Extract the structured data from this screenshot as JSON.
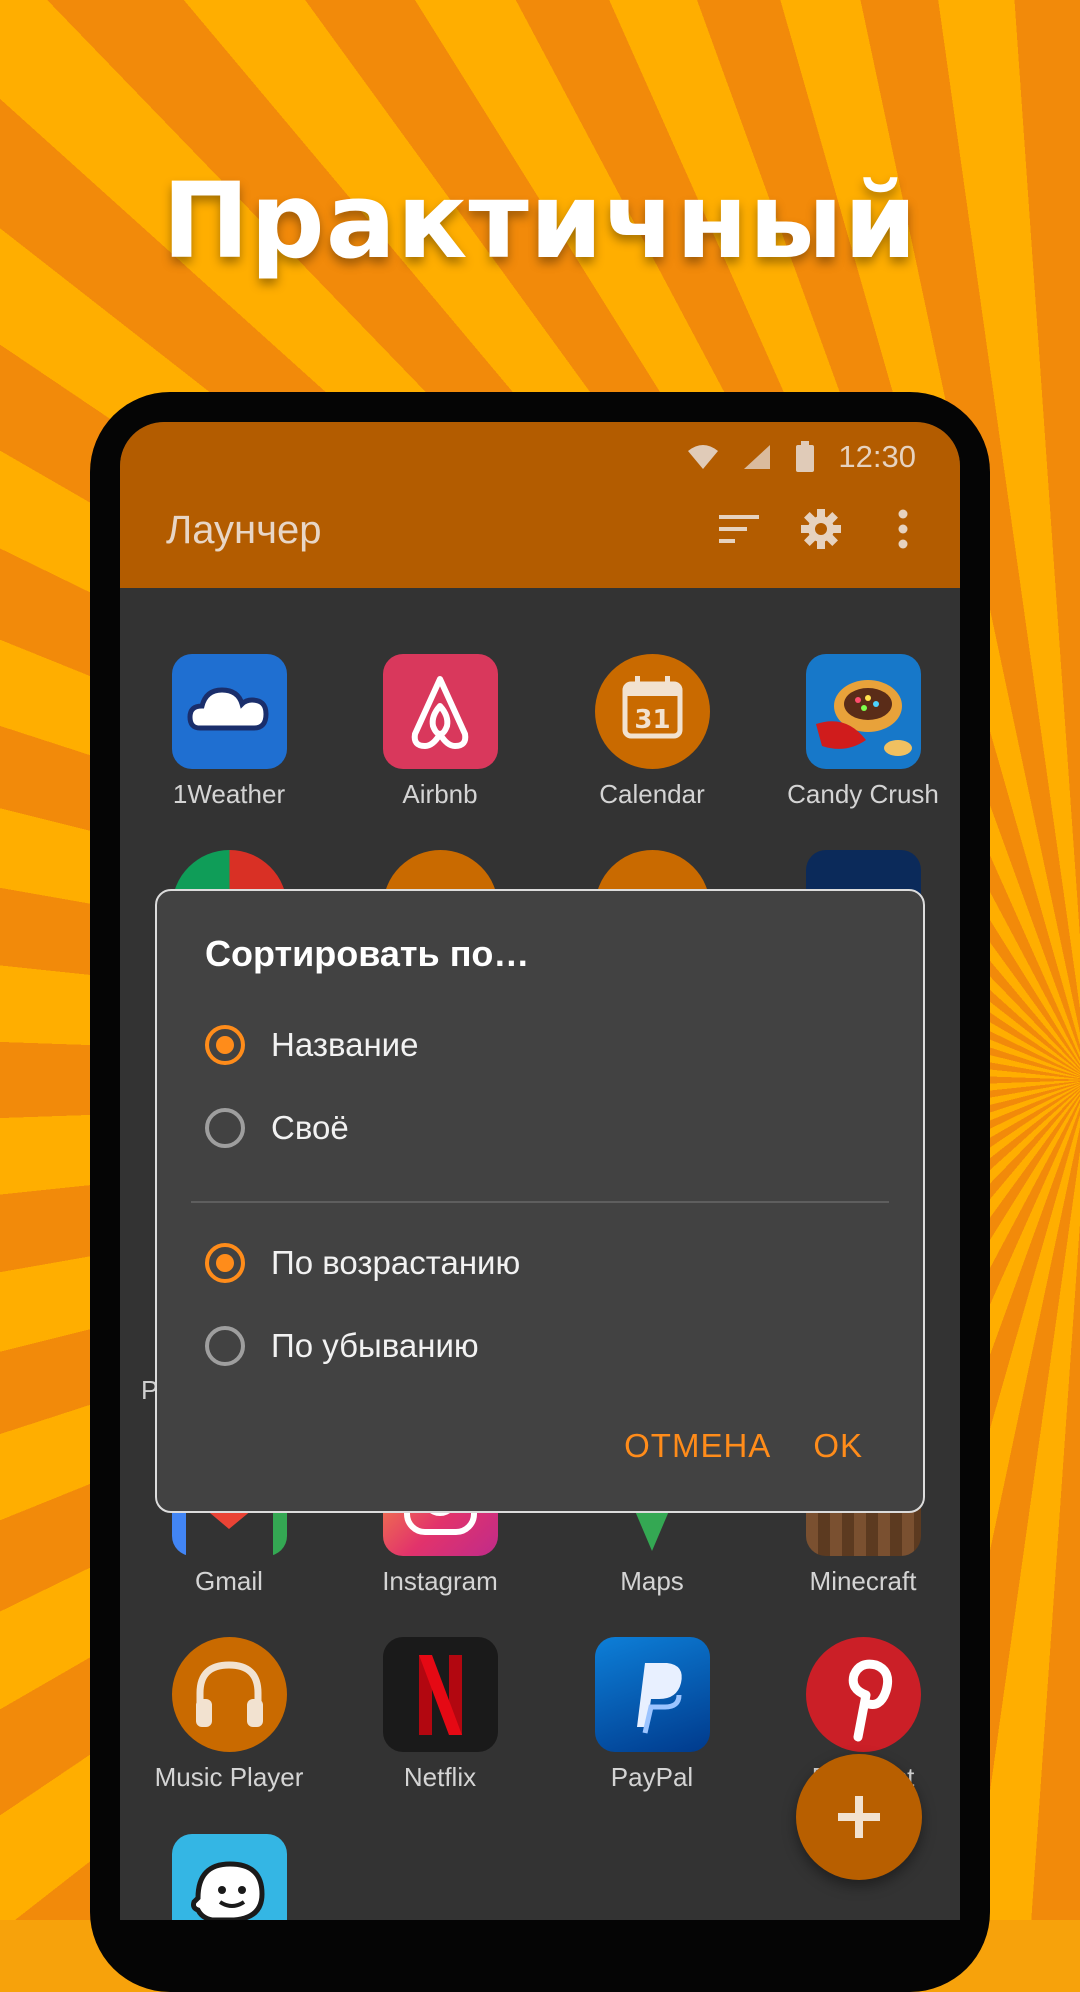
{
  "headline": "Практичный",
  "status_bar": {
    "time": "12:30",
    "icons": [
      "wifi-icon",
      "signal-icon",
      "battery-icon"
    ]
  },
  "app_bar": {
    "title": "Лаунчер",
    "actions": [
      "sort-icon",
      "settings-gear-icon",
      "overflow-menu-icon"
    ]
  },
  "apps": [
    {
      "label": "1Weather",
      "icon": "weather-cloud-icon"
    },
    {
      "label": "Airbnb",
      "icon": "airbnb-icon"
    },
    {
      "label": "Calendar",
      "icon": "calendar-31-icon"
    },
    {
      "label": "Candy Crush",
      "icon": "candy-crush-icon"
    },
    {
      "label": "Gmail",
      "icon": "gmail-icon"
    },
    {
      "label": "Instagram",
      "icon": "instagram-icon"
    },
    {
      "label": "Maps",
      "icon": "maps-icon"
    },
    {
      "label": "Minecraft",
      "icon": "minecraft-icon"
    },
    {
      "label": "Music Player",
      "icon": "headphones-icon"
    },
    {
      "label": "Netflix",
      "icon": "netflix-icon"
    },
    {
      "label": "PayPal",
      "icon": "paypal-icon"
    },
    {
      "label": "Pinterest",
      "icon": "pinterest-icon"
    },
    {
      "label": "",
      "icon": "waze-icon"
    }
  ],
  "partial_letter": "P",
  "dialog": {
    "title": "Сортировать по…",
    "sort_by": [
      {
        "label": "Название",
        "selected": true
      },
      {
        "label": "Своё",
        "selected": false
      }
    ],
    "order": [
      {
        "label": "По возрастанию",
        "selected": true
      },
      {
        "label": "По убыванию",
        "selected": false
      }
    ],
    "cancel_label": "ОТМЕНА",
    "ok_label": "OK"
  },
  "fab": {
    "icon": "plus-icon"
  },
  "colors": {
    "accent": "#ff8c1a",
    "app_bar": "#b35c00",
    "background": "#333333",
    "dialog": "#424242"
  }
}
